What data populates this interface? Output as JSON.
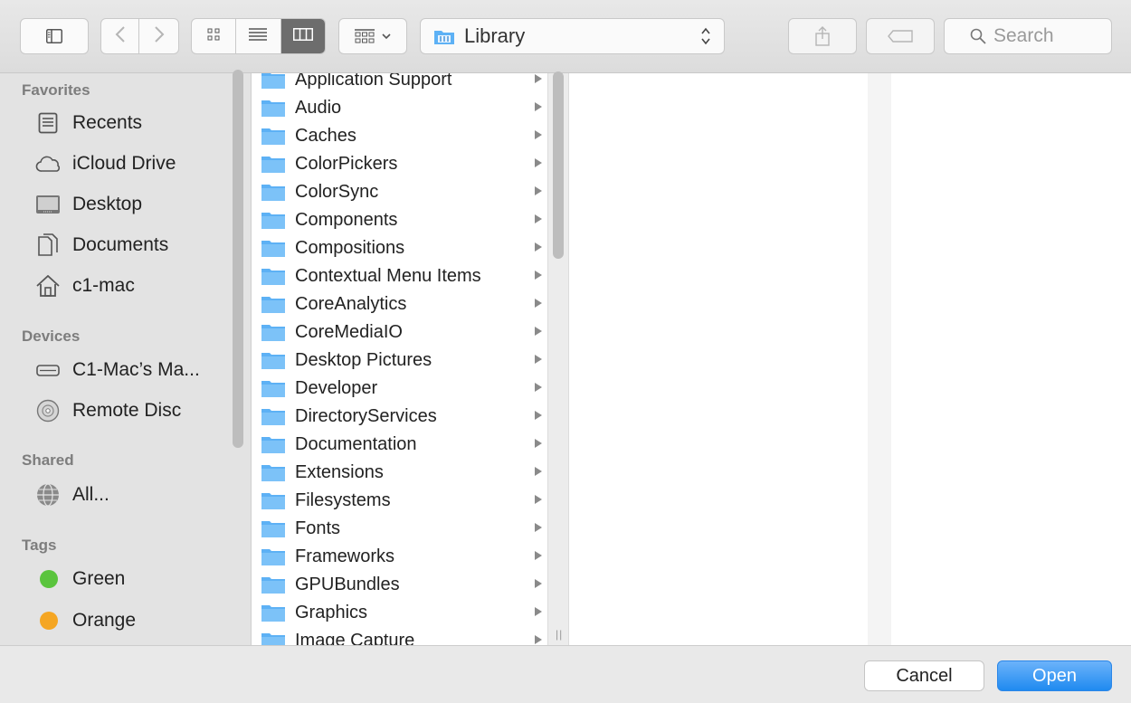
{
  "toolbar": {
    "path": {
      "label": "Library",
      "icon": "library-folder-icon"
    },
    "search": {
      "placeholder": "Search"
    },
    "view_modes": [
      "icon-view",
      "list-view",
      "column-view"
    ],
    "active_view": "column-view"
  },
  "sidebar": {
    "sections": [
      {
        "heading": "Favorites",
        "items": [
          {
            "label": "Recents",
            "icon": "recents-icon"
          },
          {
            "label": "iCloud Drive",
            "icon": "cloud-icon"
          },
          {
            "label": "Desktop",
            "icon": "desktop-icon"
          },
          {
            "label": "Documents",
            "icon": "documents-icon"
          },
          {
            "label": "c1-mac",
            "icon": "home-icon"
          }
        ]
      },
      {
        "heading": "Devices",
        "items": [
          {
            "label": "C1-Mac’s Ma...",
            "icon": "drive-icon"
          },
          {
            "label": "Remote Disc",
            "icon": "disc-icon"
          }
        ]
      },
      {
        "heading": "Shared",
        "items": [
          {
            "label": "All...",
            "icon": "network-icon"
          }
        ]
      },
      {
        "heading": "Tags",
        "items": [
          {
            "label": "Green",
            "color": "#5ac43d"
          },
          {
            "label": "Orange",
            "color": "#f5a623"
          }
        ]
      }
    ]
  },
  "column1": {
    "items": [
      "Application Support",
      "Audio",
      "Caches",
      "ColorPickers",
      "ColorSync",
      "Components",
      "Compositions",
      "Contextual Menu Items",
      "CoreAnalytics",
      "CoreMediaIO",
      "Desktop Pictures",
      "Developer",
      "DirectoryServices",
      "Documentation",
      "Extensions",
      "Filesystems",
      "Fonts",
      "Frameworks",
      "GPUBundles",
      "Graphics",
      "Image Capture"
    ]
  },
  "footer": {
    "cancel_label": "Cancel",
    "open_label": "Open"
  },
  "colors": {
    "accent": "#1f8af0",
    "folder": "#5db1f5",
    "sidebar_bg": "#e3e3e3"
  }
}
